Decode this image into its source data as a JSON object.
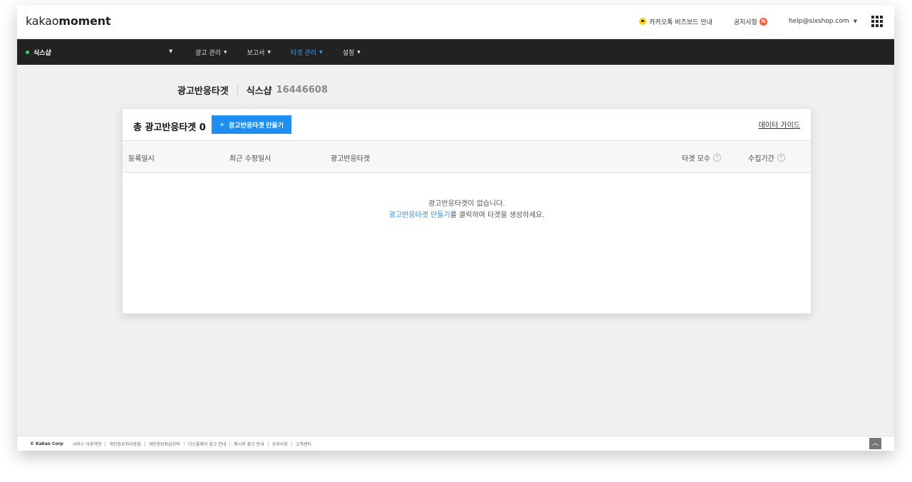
{
  "header": {
    "logo_prefix": "kakao",
    "logo_bold": "moment",
    "kakaotalk_guide": "카카오톡 비즈보드 안내",
    "notice": "공지사항",
    "notice_badge": "N",
    "email": "help@sixshop.com"
  },
  "nav": {
    "account_name": "식스샵",
    "menu": [
      {
        "label": "광고 관리"
      },
      {
        "label": "보고서"
      },
      {
        "label": "타겟 관리"
      },
      {
        "label": "설정"
      }
    ],
    "active_menu": "타겟 관리"
  },
  "page": {
    "title": "광고반응타겟",
    "account_name": "식스샵",
    "account_id": "16446608"
  },
  "card": {
    "total_label": "총 광고반응타겟 0",
    "create_button": "광고반응타겟 만들기",
    "guide_link": "데이터 가이드",
    "columns": [
      "등록일시",
      "최근 수정일시",
      "광고반응타겟",
      "타겟 모수",
      "수집기간"
    ],
    "empty_line1": "광고반응타겟이 없습니다.",
    "empty_link": "광고반응타겟 만들기",
    "empty_line2_rest": "를 클릭하여 타겟을 생성하세요."
  },
  "footer": {
    "copyright": "© Kakao Corp",
    "links": [
      "서비스 이용약관",
      "개인정보처리방침",
      "개인정보취급위탁",
      "디스플레이 광고 안내",
      "메시지 광고 안내",
      "공지사항",
      "고객센터"
    ]
  },
  "colors": {
    "accent": "#1f8ef1",
    "nav_bg": "#222222",
    "badge": "#ff5a3c"
  }
}
